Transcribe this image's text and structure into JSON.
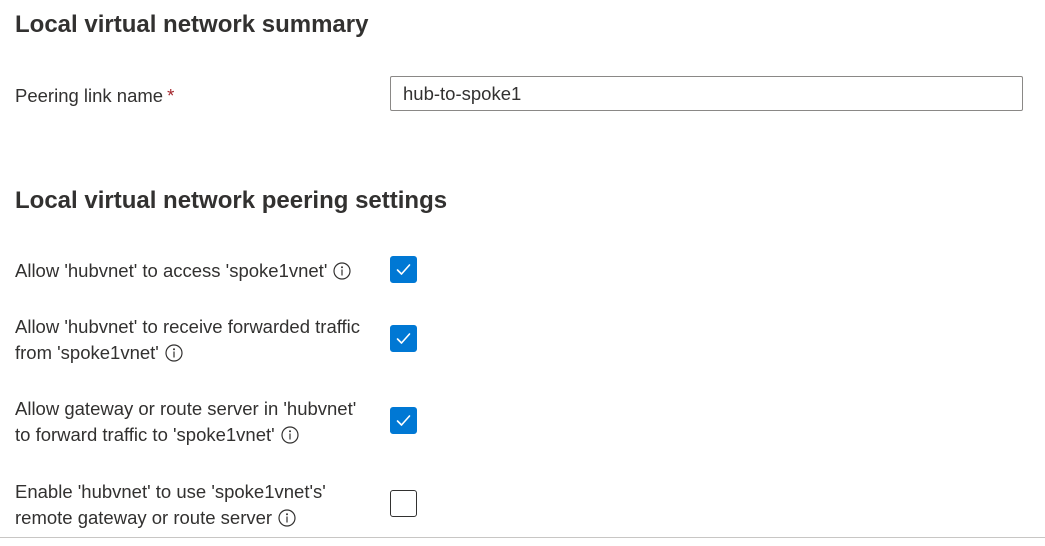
{
  "summary": {
    "heading": "Local virtual network summary",
    "peering_link_label": "Peering link name",
    "required_marker": "*",
    "peering_link_value": "hub-to-spoke1"
  },
  "settings": {
    "heading": "Local virtual network peering settings",
    "items": [
      {
        "line1": "Allow 'hubvnet' to access 'spoke1vnet'",
        "line2": "",
        "checked": true
      },
      {
        "line1": "Allow 'hubvnet' to receive forwarded traffic",
        "line2": "from 'spoke1vnet'",
        "checked": true
      },
      {
        "line1": "Allow gateway or route server in 'hubvnet'",
        "line2": "to forward traffic to 'spoke1vnet'",
        "checked": true
      },
      {
        "line1": "Enable 'hubvnet' to use 'spoke1vnet's'",
        "line2": "remote gateway or route server",
        "checked": false
      }
    ]
  },
  "icons": {
    "info": "info-icon",
    "check": "checkmark-icon"
  },
  "colors": {
    "accent": "#0078d4",
    "required": "#a4262c",
    "text": "#323130",
    "border": "#8a8886"
  }
}
